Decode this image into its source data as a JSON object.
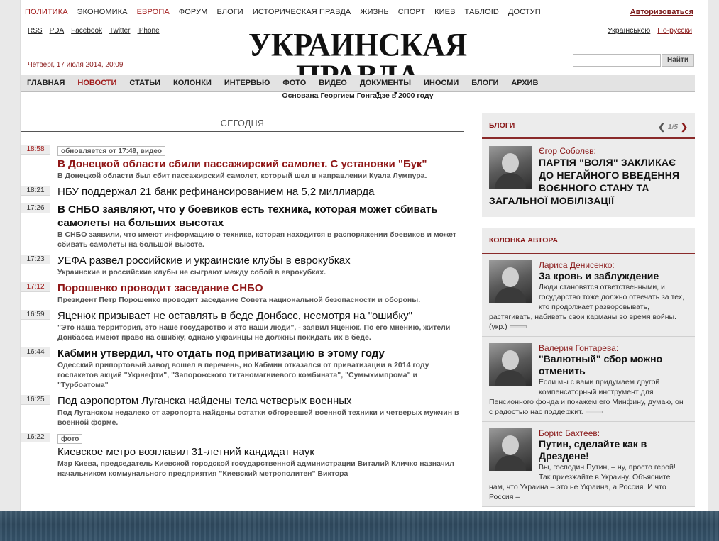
{
  "topnav": {
    "items": [
      "ПОЛИТИКА",
      "ЭКОНОМИКА",
      "ЕВРОПА",
      "ФОРУМ",
      "БЛОГИ",
      "ИСТОРИЧЕСКАЯ ПРАВДА",
      "ЖИЗНЬ",
      "СПОРТ",
      "КИЕВ",
      "ТАБЛОID",
      "ДОСТУП"
    ],
    "login": "Авторизоваться"
  },
  "sublinks": [
    "RSS",
    "PDA",
    "Facebook",
    "Twitter",
    "iPhone"
  ],
  "langs": [
    "Українською",
    "По-русски"
  ],
  "logo": {
    "title": "УКРАИНСКАЯ ПРАВДА",
    "subtitle": "Основана Георгием Гонгадзе в 2000 году"
  },
  "date": "Четверг, 17 июля 2014, 20:09",
  "search": {
    "placeholder": "",
    "button": "Найти"
  },
  "mainnav": [
    "ГЛАВНАЯ",
    "НОВОСТИ",
    "СТАТЬИ",
    "КОЛОНКИ",
    "ИНТЕРВЬЮ",
    "ФОТО",
    "ВИДЕО",
    "ДОКУМЕНТЫ",
    "ИНОСМИ",
    "БЛОГИ",
    "АРХИВ"
  ],
  "section_title": "СЕГОДНЯ",
  "news": [
    {
      "time": "18:58",
      "tag": "обновляется от 17:49, видео",
      "headline": "В Донецкой области сбили пассажирский самолет. С установки \"Бук\"",
      "lead": "В Донецкой области был сбит пассажирский самолет, который шел в направлении Куала Лумпура."
    },
    {
      "time": "18:21",
      "tag": "",
      "headline": "НБУ поддержал 21 банк рефинансированием на 5,2 миллиарда",
      "lead": ""
    },
    {
      "time": "17:26",
      "tag": "",
      "headline": "В СНБО заявляют, что у боевиков есть техника, которая может сбивать самолеты на больших высотах",
      "lead": "В СНБО заявили, что имеют информацию о технике, которая находится в распоряжении боевиков и может сбивать самолеты на большой высоте."
    },
    {
      "time": "17:23",
      "tag": "",
      "headline": "УЕФА развел российские и украинские клубы в еврокубках",
      "lead": "Украинские и российские клубы не сыграют между собой в еврокубках."
    },
    {
      "time": "17:12",
      "tag": "",
      "headline": "Порошенко проводит заседание СНБО",
      "lead": "Президент Петр Порошенко проводит заседание Совета национальной безопасности и обороны."
    },
    {
      "time": "16:59",
      "tag": "",
      "headline": "Яценюк призывает не оставлять в беде Донбасс, несмотря на \"ошибку\"",
      "lead": "\"Это наша территория, это наше государство и это наши люди\", - заявил Яценюк. По его мнению, жители Донбасса имеют право на ошибку, однако украинцы не должны покидать их в беде."
    },
    {
      "time": "16:44",
      "tag": "",
      "headline": "Кабмин утвердил, что отдать под приватизацию в этому году",
      "lead": "Одесский припортовый завод вошел в перечень, но Кабмин отказался от приватизации в 2014 году госпакетов акций \"Укрнефти\", \"Запорожского титаномагниевого комбината\", \"Сумыхимпрома\" и \"Турбоатома\""
    },
    {
      "time": "16:25",
      "tag": "",
      "headline": "Под аэропортом Луганска найдены тела четверых военных",
      "lead": "Под Луганском недалеко от аэропорта найдены остатки обгоревшей военной техники и четверых мужчин в военной форме."
    },
    {
      "time": "16:22",
      "tag": "фото",
      "headline": "Киевское метро возглавил 31-летний кандидат наук",
      "lead": "Мэр Киева, председатель Киевской городской государственной администрации Виталий Кличко назначил начальником коммунального предприятия \"Киевский метрополитен\" Виктора"
    }
  ],
  "blogs": {
    "title": "БЛОГИ",
    "pager": "1/5",
    "author": "Єгор Соболєв:",
    "post_title": "ПАРТІЯ \"ВОЛЯ\" ЗАКЛИКАЄ ДО НЕГАЙНОГО ВВЕДЕННЯ ВОЄННОГО СТАНУ ТА ЗАГАЛЬНОЇ МОБІЛІЗАЦІЇ"
  },
  "columns": {
    "title": "КОЛОНКА АВТОРА",
    "items": [
      {
        "author": "Лариса Денисенко:",
        "title": "За кровь и заблуждение",
        "text": "Люди становятся ответственными, и государство тоже должно отвечать за тех, кто продолжает разворовывать, растягивать, набивать свои карманы во время войны. (укр.)"
      },
      {
        "author": "Валерия Гонтарева:",
        "title": "\"Валютный\" сбор можно отменить",
        "text": "Если мы с вами придумаем другой компенсаторный инструмент для Пенсионного фонда и покажем его Минфину, думаю, он с радостью нас поддержит."
      },
      {
        "author": "Борис Бахтеев:",
        "title": "Путин, сделайте как в Дрездене!",
        "text": "Вы, господин Путин, – ну, просто герой! Так приезжайте в Украину. Объясните нам, что Украина – это не Украина, а Россия. И что Россия –"
      }
    ]
  }
}
